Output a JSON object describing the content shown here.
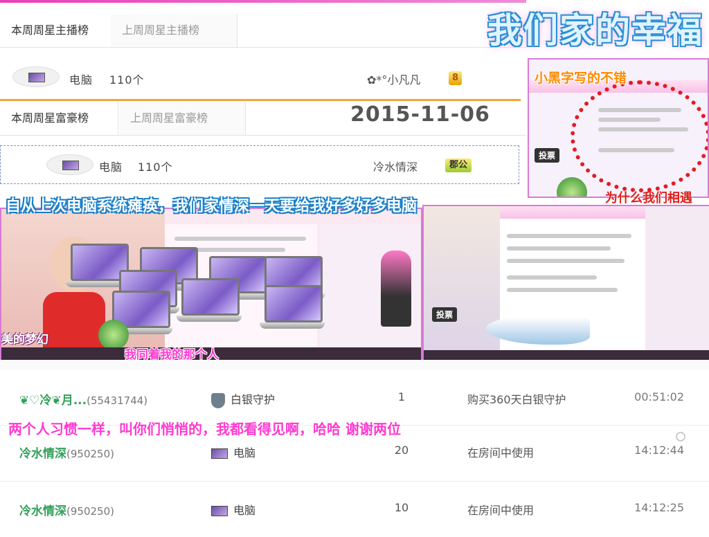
{
  "rank_panel": {
    "host_tabs": [
      "本周周星主播榜",
      "上周周星主播榜"
    ],
    "host_row": {
      "gift": "电脑",
      "count": "110个",
      "winner": "✿*°小凡凡",
      "badge": "8"
    },
    "rich_tabs": [
      "本周周星富豪榜",
      "上周周星富豪榜"
    ],
    "rich_row": {
      "gift": "电脑",
      "count": "110个",
      "winner": "冷水情深",
      "badge": "郡公"
    }
  },
  "overlays": {
    "title": "我们家的幸福",
    "date": "2015-11-06",
    "caption_top_right": "小黑字写的不错",
    "caption_middle": "自从上次电脑系统瘫痪，我们家情深一天要给我好多好多电脑",
    "caption_heart": "为什么我们相遇",
    "caption_lower_left": "我同着我的那个人",
    "caption_bottom": "两个人习惯一样，叫你们悄悄的，我都看得见啊，哈哈 谢谢两位",
    "sticker_left": "美的梦幻",
    "vote_label": "投票"
  },
  "records": [
    {
      "user": "❦♡冷❦月...",
      "uid": "(55431744)",
      "gift": "白银守护",
      "icon": "shield-icon",
      "qty": "1",
      "status": "购买360天白银守护",
      "time": "00:51:02"
    },
    {
      "user": "冷水情深",
      "uid": "(950250)",
      "gift": "电脑",
      "icon": "laptop-icon",
      "qty": "20",
      "status": "在房间中使用",
      "time": "14:12:44"
    },
    {
      "user": "冷水情深",
      "uid": "(950250)",
      "gift": "电脑",
      "icon": "laptop-icon",
      "qty": "10",
      "status": "在房间中使用",
      "time": "14:12:25"
    }
  ],
  "colors": {
    "accent_pink": "#ff3ad0",
    "title_blue": "#2d8fd6",
    "user_green": "#33a05a",
    "tab_orange": "#f7a23b"
  }
}
